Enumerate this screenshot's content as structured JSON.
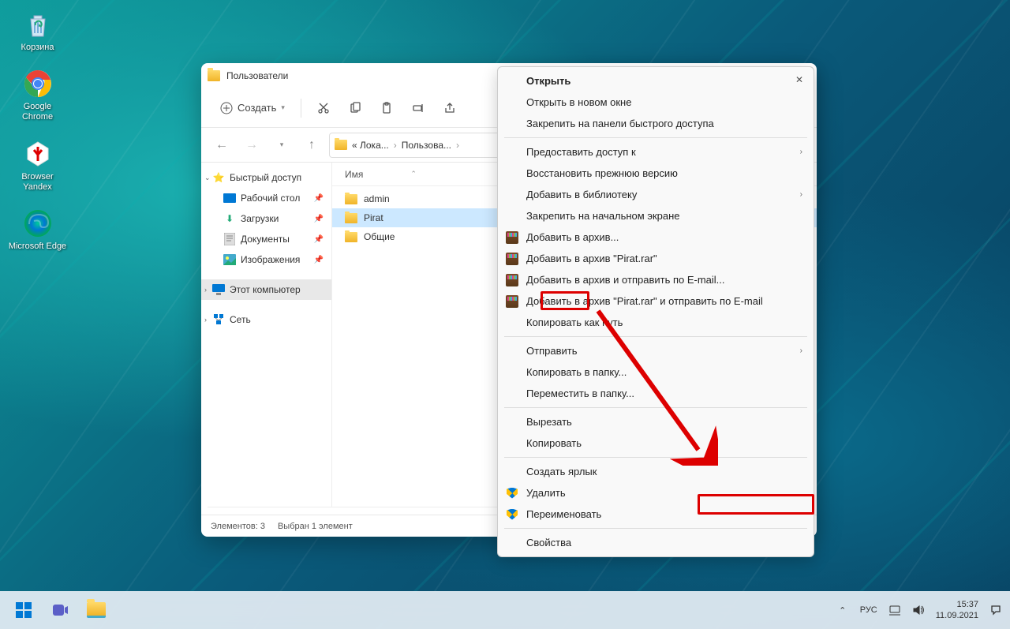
{
  "desktop": {
    "icons": [
      {
        "name": "recycle-bin",
        "label": "Корзина"
      },
      {
        "name": "chrome",
        "label": "Google Chrome"
      },
      {
        "name": "yandex",
        "label": "Browser Yandex"
      },
      {
        "name": "edge",
        "label": "Microsoft Edge"
      }
    ]
  },
  "window": {
    "title": "Пользователи",
    "new_button": "Создать",
    "breadcrumb": [
      "« Лока...",
      "Пользова..."
    ],
    "column_name": "Имя",
    "sidebar": {
      "quick_access": "Быстрый доступ",
      "desktop": "Рабочий стол",
      "downloads": "Загрузки",
      "documents": "Документы",
      "pictures": "Изображения",
      "this_pc": "Этот компьютер",
      "network": "Сеть"
    },
    "files": [
      {
        "name": "admin"
      },
      {
        "name": "Pirat",
        "selected": true
      },
      {
        "name": "Общие"
      }
    ],
    "status": {
      "count": "Элементов: 3",
      "selected": "Выбран 1 элемент"
    }
  },
  "context_menu": {
    "open": "Открыть",
    "open_new_window": "Открыть в новом окне",
    "pin_quick_access": "Закрепить на панели быстрого доступа",
    "grant_access": "Предоставить доступ к",
    "restore_version": "Восстановить прежнюю версию",
    "add_library": "Добавить в библиотеку",
    "pin_start": "Закрепить на начальном экране",
    "add_archive": "Добавить в архив...",
    "add_pirat_rar": "Добавить в архив \"Pirat.rar\"",
    "add_email": "Добавить в архив и отправить по E-mail...",
    "add_pirat_email": "Добавить в архив \"Pirat.rar\" и отправить по E-mail",
    "copy_path": "Копировать как путь",
    "send_to": "Отправить",
    "copy_to_folder": "Копировать в папку...",
    "move_to_folder": "Переместить в папку...",
    "cut": "Вырезать",
    "copy": "Копировать",
    "create_shortcut": "Создать ярлык",
    "delete": "Удалить",
    "rename": "Переименовать",
    "properties": "Свойства"
  },
  "taskbar": {
    "lang": "РУС",
    "time": "15:37",
    "date": "11.09.2021"
  }
}
